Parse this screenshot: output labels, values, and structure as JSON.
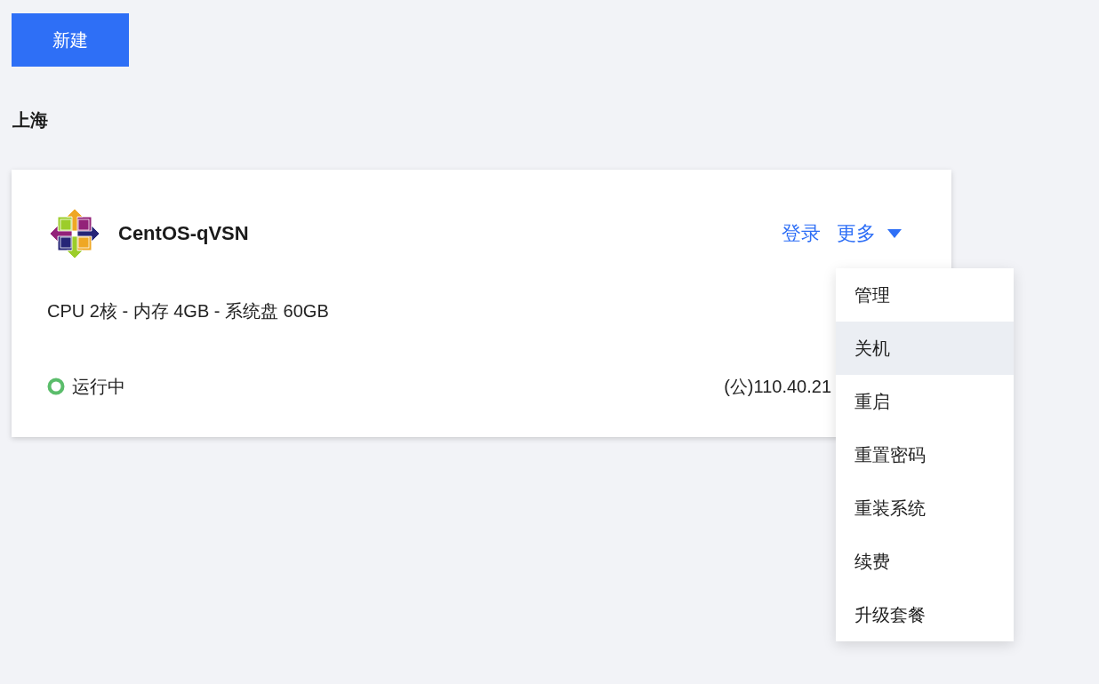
{
  "create_button": {
    "label": "新建"
  },
  "region": {
    "title": "上海"
  },
  "server_card": {
    "name": "CentOS-qVSN",
    "login_link": "登录",
    "more": {
      "label": "更多",
      "expanded": true,
      "menu": [
        {
          "label": "管理",
          "hovered": false
        },
        {
          "label": "关机",
          "hovered": true
        },
        {
          "label": "重启",
          "hovered": false
        },
        {
          "label": "重置密码",
          "hovered": false
        },
        {
          "label": "重装系统",
          "hovered": false
        },
        {
          "label": "续费",
          "hovered": false
        },
        {
          "label": "升级套餐",
          "hovered": false
        }
      ]
    },
    "specs": "CPU 2核 - 内存 4GB - 系统盘 60GB",
    "status": {
      "kind": "running",
      "label": "运行中"
    },
    "ip": "(公)110.40.21"
  }
}
